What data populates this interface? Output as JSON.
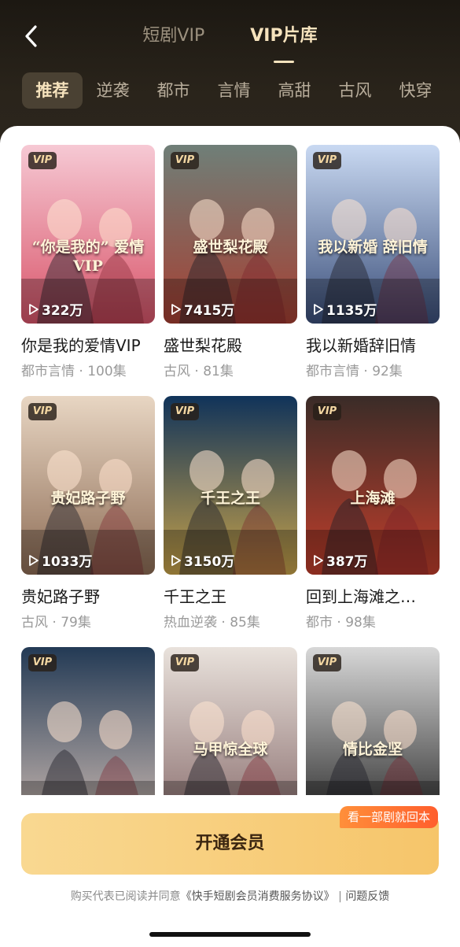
{
  "header": {
    "tabs": [
      {
        "label": "短剧VIP",
        "active": false
      },
      {
        "label": "VIP片库",
        "active": true
      }
    ]
  },
  "categories": [
    {
      "label": "推荐",
      "active": true
    },
    {
      "label": "逆袭"
    },
    {
      "label": "都市"
    },
    {
      "label": "言情"
    },
    {
      "label": "高甜"
    },
    {
      "label": "古风"
    },
    {
      "label": "快穿"
    }
  ],
  "dramas": [
    {
      "badge": "VIP",
      "plays": "322万",
      "title": "你是我的爱情VIP",
      "meta": "都市言情 · 100集",
      "poster_text": "“你是我的” 爱情VIP",
      "colors": [
        "#f6c9d4",
        "#d9556a"
      ]
    },
    {
      "badge": "VIP",
      "plays": "7415万",
      "title": "盛世梨花殿",
      "meta": "古风 · 81集",
      "poster_text": "盛世梨花殿",
      "colors": [
        "#6f7f78",
        "#a64033"
      ]
    },
    {
      "badge": "VIP",
      "plays": "1135万",
      "title": "我以新婚辞旧情",
      "meta": "都市言情 · 92集",
      "poster_text": "我以新婚 辞旧情",
      "colors": [
        "#c9d9f2",
        "#3b4f7a"
      ]
    },
    {
      "badge": "VIP",
      "plays": "1033万",
      "title": "贵妃路子野",
      "meta": "古风 · 79集",
      "poster_text": "贵妃路子野",
      "colors": [
        "#e8d6c3",
        "#8d6c55"
      ]
    },
    {
      "badge": "VIP",
      "plays": "3150万",
      "title": "千王之王",
      "meta": "热血逆袭 · 85集",
      "poster_text": "千王之王",
      "colors": [
        "#10335a",
        "#c7a24a"
      ]
    },
    {
      "badge": "VIP",
      "plays": "387万",
      "title": "回到上海滩之…",
      "meta": "都市 · 98集",
      "poster_text": "上海滩",
      "colors": [
        "#3a2c28",
        "#c13e2b"
      ]
    },
    {
      "badge": "VIP",
      "plays": "",
      "title": "",
      "meta": "",
      "poster_text": "",
      "colors": [
        "#233a55",
        "#c9b8b0"
      ]
    },
    {
      "badge": "VIP",
      "plays": "",
      "title": "",
      "meta": "",
      "poster_text": "马甲惊全球",
      "colors": [
        "#e9e2dc",
        "#8a6e6e"
      ]
    },
    {
      "badge": "VIP",
      "plays": "",
      "title": "",
      "meta": "",
      "poster_text": "情比金坚",
      "colors": [
        "#d8d8d8",
        "#2b2b2b"
      ]
    }
  ],
  "promo": {
    "tag": "看一部剧就回本",
    "button": "开通会员"
  },
  "agreement": {
    "prefix": "购买代表已阅读并同意",
    "link": "《快手短剧会员消费服务协议》",
    "separator": " | ",
    "feedback": "问题反馈"
  },
  "theme": {
    "gold": "#f6e3bd",
    "button_gold": "#f6c56a",
    "promo_orange": "#ff6a2f"
  },
  "icons": {
    "back": "chevron-left-icon",
    "play": "play-icon"
  }
}
